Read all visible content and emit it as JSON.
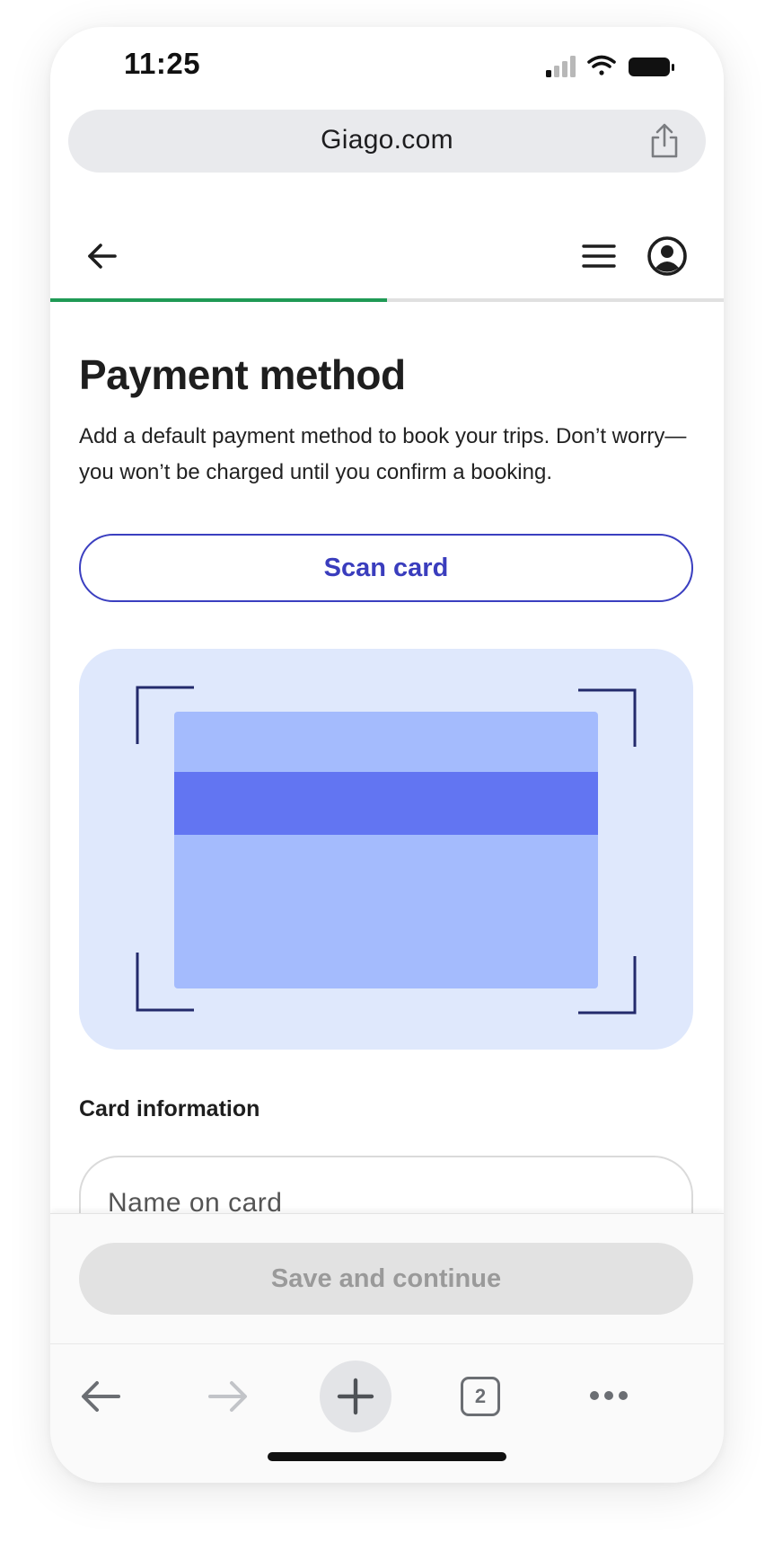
{
  "status_bar": {
    "time": "11:25"
  },
  "browser": {
    "url": "Giago.com",
    "open_tabs": "2"
  },
  "progress": {
    "fraction": 0.5,
    "accent_color": "#1f9a55"
  },
  "page": {
    "title": "Payment method",
    "subtitle": "Add a default payment method to book your trips. Don’t worry—you won’t be charged until you confirm a booking.",
    "scan_button_label": "Scan card",
    "section_label": "Card information",
    "name_placeholder": "Name on card",
    "save_button_label": "Save and continue"
  },
  "colors": {
    "brand": "#3a3dbd",
    "scan_area_bg": "#dfe8fc",
    "card_fill": "#a4bbfd",
    "card_stripe": "#6275f2",
    "frame_corners": "#232a6b"
  },
  "icons": {
    "header_back": "arrow-left-icon",
    "header_menu": "hamburger-menu-icon",
    "header_account": "account-circle-icon",
    "browser_share": "share-icon",
    "toolbar_back": "arrow-left-icon",
    "toolbar_forward": "arrow-right-icon",
    "toolbar_new_tab": "plus-icon",
    "toolbar_more": "more-horizontal-icon"
  }
}
